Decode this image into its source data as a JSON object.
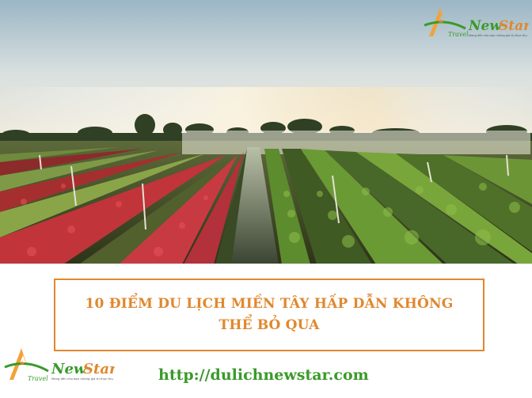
{
  "brand": {
    "name": "NewStar",
    "sub": "Travel",
    "tagline": "Mang đến cho bạn những giá trị thực thụ"
  },
  "hero": {
    "alt": "Cánh đồng hoa"
  },
  "article": {
    "title_line1": "10 ĐIỂM DU LỊCH MIỀN TÂY HẤP DẪN KHÔNG",
    "title_line2": "THỂ BỎ QUA"
  },
  "footer": {
    "url": "http://dulichnewstar.com"
  },
  "colors": {
    "title": "#e0882e",
    "url": "#3a9a2a",
    "brand_green": "#3a9a2a",
    "brand_orange": "#f2a23a"
  }
}
